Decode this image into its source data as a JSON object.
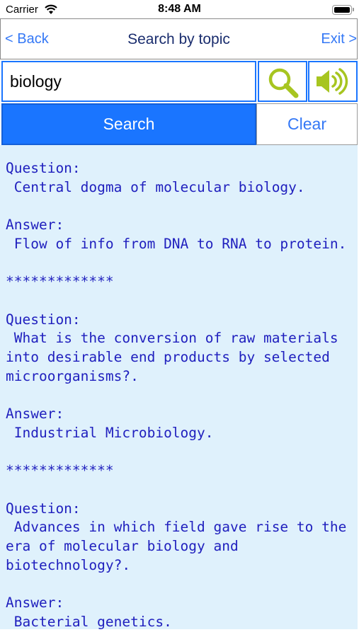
{
  "status_bar": {
    "carrier": "Carrier",
    "time": "8:48 AM"
  },
  "nav": {
    "back_label": "< Back",
    "title": "Search by topic",
    "exit_label": "Exit >"
  },
  "search": {
    "value": "biology"
  },
  "actions": {
    "search_label": "Search",
    "clear_label": "Clear"
  },
  "colors": {
    "accent": "#1a75ff",
    "link": "#3478f6",
    "content_bg": "#dff1fc",
    "text": "#1f1fbe",
    "icon_green": "#a7c520"
  },
  "icons": {
    "search": "magnifier-icon",
    "speak": "speaker-icon"
  },
  "results": [
    {
      "question_label": "Question:",
      "question": " Central dogma of molecular biology.",
      "answer_label": "Answer:",
      "answer": " Flow of info from DNA to RNA to protein.",
      "separator": "*************"
    },
    {
      "question_label": "Question:",
      "question": " What is the conversion of raw materials into desirable end products by selected microorganisms?.",
      "answer_label": "Answer:",
      "answer": " Industrial Microbiology.",
      "separator": "*************"
    },
    {
      "question_label": "Question:",
      "question": " Advances in which field gave rise to the era of molecular biology and biotechnology?.",
      "answer_label": "Answer:",
      "answer": " Bacterial genetics."
    }
  ]
}
